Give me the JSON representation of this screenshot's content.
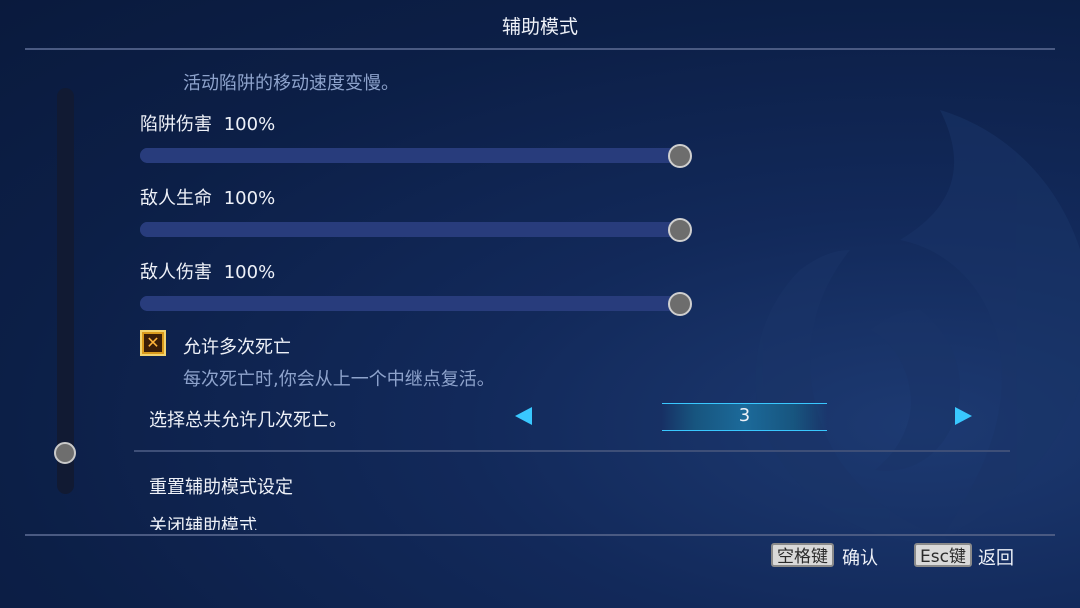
{
  "header": {
    "title": "辅助模式"
  },
  "content": {
    "trap_speed_desc": "活动陷阱的移动速度变慢。",
    "trap_damage": {
      "label": "陷阱伤害",
      "value": "100%",
      "level": 1.0
    },
    "enemy_health": {
      "label": "敌人生命",
      "value": "100%",
      "level": 1.0
    },
    "enemy_damage": {
      "label": "敌人伤害",
      "value": "100%",
      "level": 1.0
    },
    "multiple_deaths": {
      "label": "允许多次死亡",
      "checked": true,
      "desc": "每次死亡时,你会从上一个中继点复活。"
    },
    "death_count": {
      "label": "选择总共允许几次死亡。",
      "value": "3"
    },
    "reset_label": "重置辅助模式设定",
    "cut_off_label": "关闭辅助模式"
  },
  "scroll": {
    "position": 0.9
  },
  "footer": {
    "confirm_key": "空格键",
    "confirm_label": "确认",
    "back_key": "Esc键",
    "back_label": "返回"
  },
  "colors": {
    "accent": "#39c8ff",
    "track": "#283c7c",
    "checkbox": "#d99a1d"
  }
}
